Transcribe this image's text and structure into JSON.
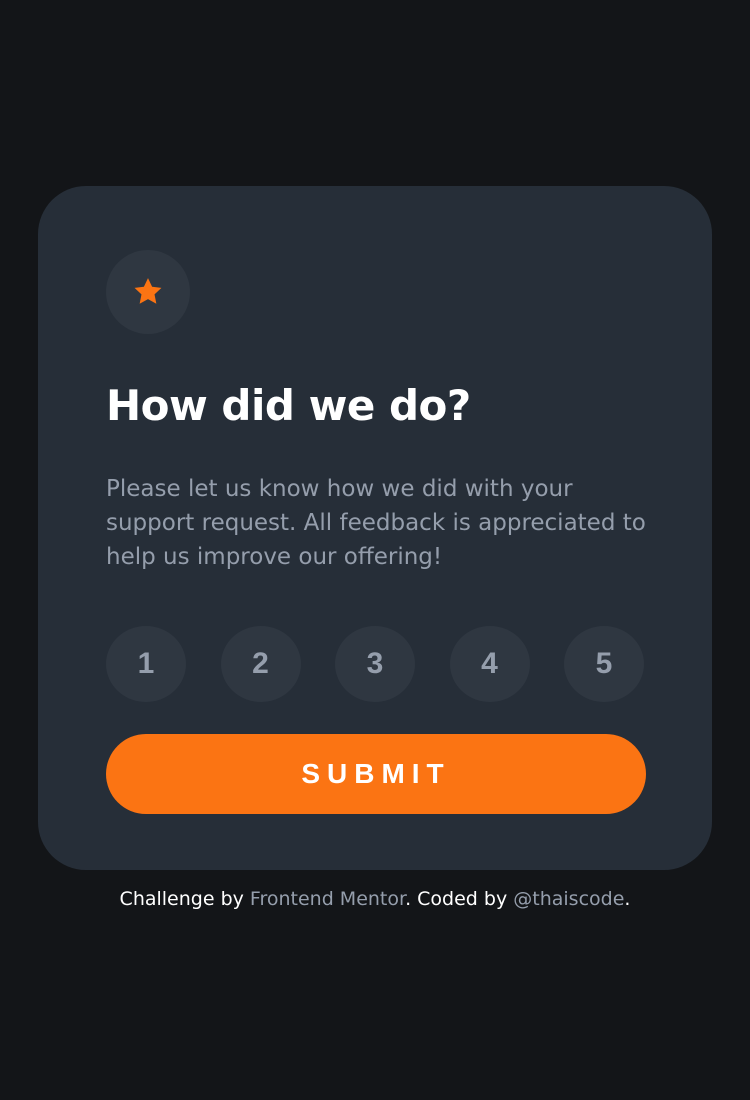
{
  "card": {
    "title": "How did we do?",
    "description": "Please let us know how we did with your support request. All feedback is appreciated to help us improve our offering!",
    "ratings": [
      "1",
      "2",
      "3",
      "4",
      "5"
    ],
    "submit_label": "SUBMIT",
    "icon": "star-icon"
  },
  "attribution": {
    "prefix": "Challenge by ",
    "link1": "Frontend Mentor",
    "middle": ". Coded by ",
    "link2": "@thaiscode",
    "suffix": "."
  },
  "colors": {
    "background": "#131518",
    "card": "#262e38",
    "circle": "#2f3741",
    "accent": "#fb7413",
    "muted_text": "#959eac",
    "text": "#ffffff"
  }
}
